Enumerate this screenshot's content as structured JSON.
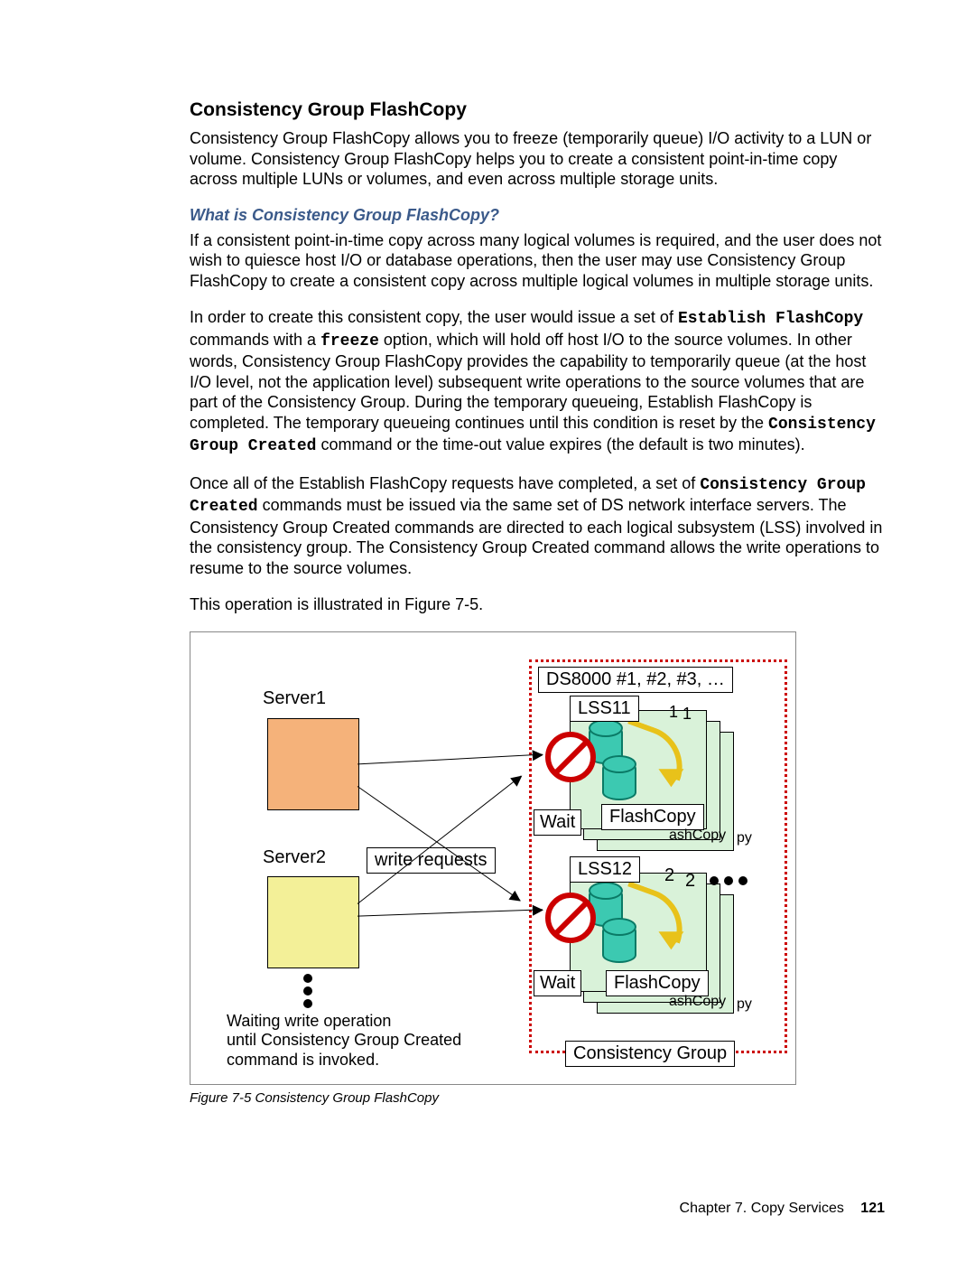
{
  "section_title": "Consistency Group FlashCopy",
  "intro_para": "Consistency Group FlashCopy allows you to freeze (temporarily queue) I/O activity to a LUN or volume. Consistency Group FlashCopy helps you to create a consistent point-in-time copy across multiple LUNs or volumes, and even across multiple storage units.",
  "subheading": "What is Consistency Group FlashCopy?",
  "para1": "If a consistent point-in-time copy across many logical volumes is required, and the user does not wish to quiesce host I/O or database operations, then the user may use Consistency Group FlashCopy to create a consistent copy across multiple logical volumes in multiple storage units.",
  "para2_a": "In order to create this consistent copy, the user would issue a set of ",
  "para2_cmd1": "Establish FlashCopy",
  "para2_b": " commands with a ",
  "para2_cmd2": "freeze",
  "para2_c": " option, which will hold off host I/O to the source volumes. In other words, Consistency Group FlashCopy provides the capability to temporarily queue (at the host I/O level, not the application level) subsequent write operations to the source volumes that are part of the Consistency Group. During the temporary queueing, Establish FlashCopy is completed. The temporary queueing continues until this condition is reset by the ",
  "para2_cmd3": "Consistency Group Created",
  "para2_d": " command or the time-out value expires (the default is two minutes).",
  "para3_a": "Once all of the Establish FlashCopy requests have completed, a set of ",
  "para3_cmd1": "Consistency Group Created",
  "para3_b": " commands must be issued via the same set of DS network interface servers. The Consistency Group Created commands are directed to each logical subsystem (LSS) involved in the consistency group. The Consistency Group Created command allows the write operations to resume to the source volumes.",
  "para4": "This operation is illustrated in Figure 7-5.",
  "figure": {
    "server1": "Server1",
    "server2": "Server2",
    "write_requests": "write requests",
    "ds_label": "DS8000 #1, #2, #3, …",
    "lss11": "LSS11",
    "lss12": "LSS12",
    "wait": "Wait",
    "flashcopy": "FlashCopy",
    "flashcopy_overlap_a": "ashCopy",
    "flashcopy_overlap_b": "py",
    "two_a": "2",
    "two_b": "2",
    "one_a": "1",
    "one_b": "1",
    "cg_label": "Consistency Group",
    "note_l1": "Waiting write operation",
    "note_l2": "until Consistency Group Created",
    "note_l3": "command is invoked.",
    "caption": "Figure 7-5   Consistency Group FlashCopy"
  },
  "footer_chapter": "Chapter 7. Copy Services",
  "footer_page": "121"
}
